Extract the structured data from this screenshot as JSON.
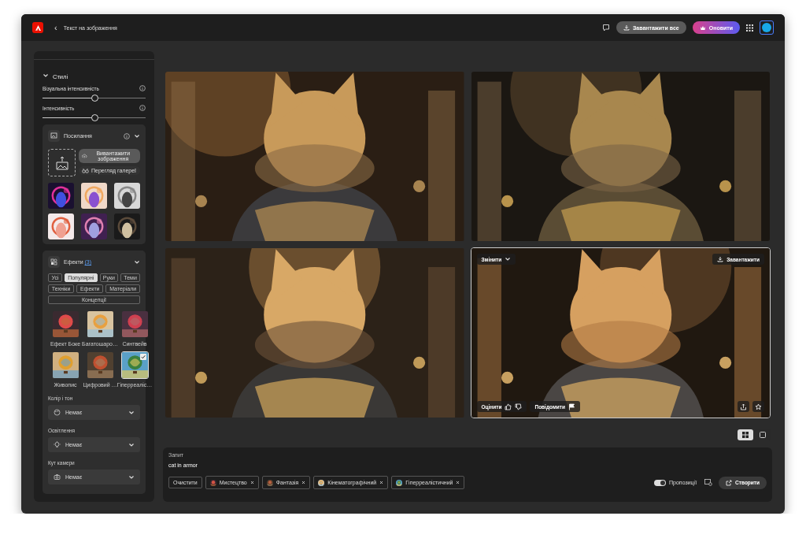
{
  "header": {
    "back": "‹",
    "title": "Текст на зображення",
    "download_all": "Завантажити все",
    "upgrade": "Оновити"
  },
  "sidebar": {
    "styles": {
      "title": "Стилі",
      "expanded": true,
      "sliders": [
        {
          "label": "Візуальна інтенсивність",
          "level": 0.5
        },
        {
          "label": "Інтенсивність",
          "level": 0.5
        }
      ]
    },
    "reference": {
      "title": "Посилання",
      "upload": "Вивантажити зображення",
      "gallery": "Перегляд галереї"
    },
    "effects": {
      "title": "Ефекти",
      "count": "(3)",
      "filters": [
        {
          "label": "Усі",
          "selected": false
        },
        {
          "label": "Популярні",
          "selected": true
        },
        {
          "label": "Руки",
          "selected": false
        },
        {
          "label": "Теми",
          "selected": false
        },
        {
          "label": "Техніки",
          "selected": false
        },
        {
          "label": "Ефекти",
          "selected": false
        },
        {
          "label": "Матеріали",
          "selected": false
        },
        {
          "label": "Концепції",
          "selected": false
        }
      ],
      "items": [
        {
          "label": "Ефект Боке",
          "selected": false
        },
        {
          "label": "Багатошаро…",
          "selected": false
        },
        {
          "label": "Синтвейв",
          "selected": false
        },
        {
          "label": "Живопис",
          "selected": false
        },
        {
          "label": "Цифровий …",
          "selected": false
        },
        {
          "label": "Гіперреаліс…",
          "selected": true
        }
      ]
    },
    "dropdowns": [
      {
        "kind": "color",
        "label": "Колір і тон",
        "value": "Немає"
      },
      {
        "kind": "light",
        "label": "Освітлення",
        "value": "Немає"
      },
      {
        "kind": "camera",
        "label": "Кут камери",
        "value": "Немає"
      }
    ]
  },
  "images": [
    {
      "selected": false
    },
    {
      "selected": false
    },
    {
      "selected": false
    },
    {
      "selected": true
    }
  ],
  "image_actions": {
    "edit": "Змінити",
    "download": "Завантажити",
    "rate": "Оцінити",
    "report": "Повідомити"
  },
  "view_modes": [
    {
      "kind": "grid",
      "selected": true
    },
    {
      "kind": "single",
      "selected": false
    }
  ],
  "prompt": {
    "label": "Запит",
    "value": "cat in armor",
    "clear": "Очистити",
    "tags": [
      {
        "label": "Мистецтво"
      },
      {
        "label": "Фантазія"
      },
      {
        "label": "Кінематографічний"
      },
      {
        "label": "Гіперреалістичний"
      }
    ],
    "suggestions": {
      "label": "Пропозиції",
      "on": true
    },
    "generate": "Створити"
  }
}
